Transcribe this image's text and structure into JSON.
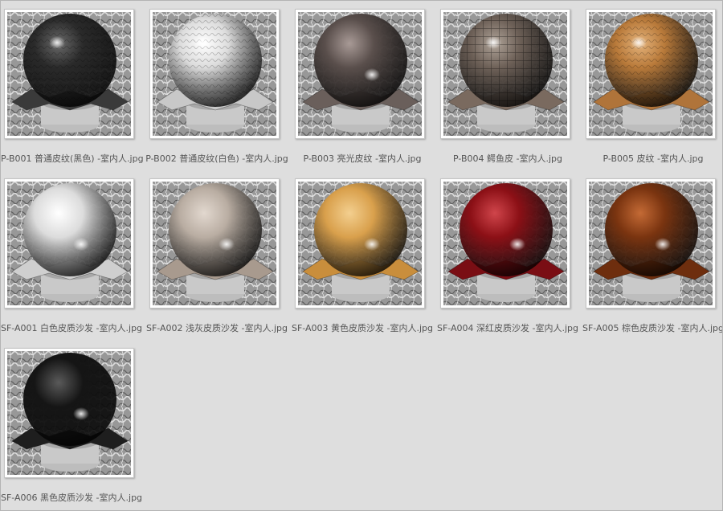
{
  "files": [
    {
      "name": "P-B001 普通皮纹(黑色) -室内人.jpg",
      "color": "#2a2a2a",
      "highlight": "#6a6a6a",
      "plate": "#3a3a3a",
      "texture": "leather"
    },
    {
      "name": "P-B002 普通皮纹(白色) -室内人.jpg",
      "color": "#dcdcdc",
      "highlight": "#ffffff",
      "plate": "#c8c8c8",
      "texture": "leather"
    },
    {
      "name": "P-B003 亮光皮纹 -室内人.jpg",
      "color": "#5a4f4c",
      "highlight": "#a89a96",
      "plate": "#6a5f5b",
      "texture": "smooth"
    },
    {
      "name": "P-B004 鳄鱼皮 -室内人.jpg",
      "color": "#6e6158",
      "highlight": "#b0a499",
      "plate": "#7a6a5f",
      "texture": "croc"
    },
    {
      "name": "P-B005 皮纹 -室内人.jpg",
      "color": "#b97a3a",
      "highlight": "#e3b27a",
      "plate": "#b0743a",
      "texture": "leather"
    },
    {
      "name": "SF-A001 白色皮质沙发 -室内人.jpg",
      "color": "#dcdcdc",
      "highlight": "#ffffff",
      "plate": "#cfcfcf",
      "texture": "smooth"
    },
    {
      "name": "SF-A002 浅灰皮质沙发 -室内人.jpg",
      "color": "#b9ada2",
      "highlight": "#e2d8cf",
      "plate": "#a89a8e",
      "texture": "smooth"
    },
    {
      "name": "SF-A003 黄色皮质沙发 -室内人.jpg",
      "color": "#d9a04c",
      "highlight": "#f3cf8f",
      "plate": "#c98e3c",
      "texture": "smooth"
    },
    {
      "name": "SF-A004 深红皮质沙发 -室内人.jpg",
      "color": "#8c1016",
      "highlight": "#d0454b",
      "plate": "#7a0e14",
      "texture": "smooth"
    },
    {
      "name": "SF-A005 棕色皮质沙发 -室内人.jpg",
      "color": "#7a3410",
      "highlight": "#c46a35",
      "plate": "#6e2e0e",
      "texture": "smooth"
    },
    {
      "name": "SF-A006 黑色皮质沙发 -室内人.jpg",
      "color": "#151515",
      "highlight": "#5a5a5a",
      "plate": "#1e1e1e",
      "texture": "smooth"
    }
  ]
}
